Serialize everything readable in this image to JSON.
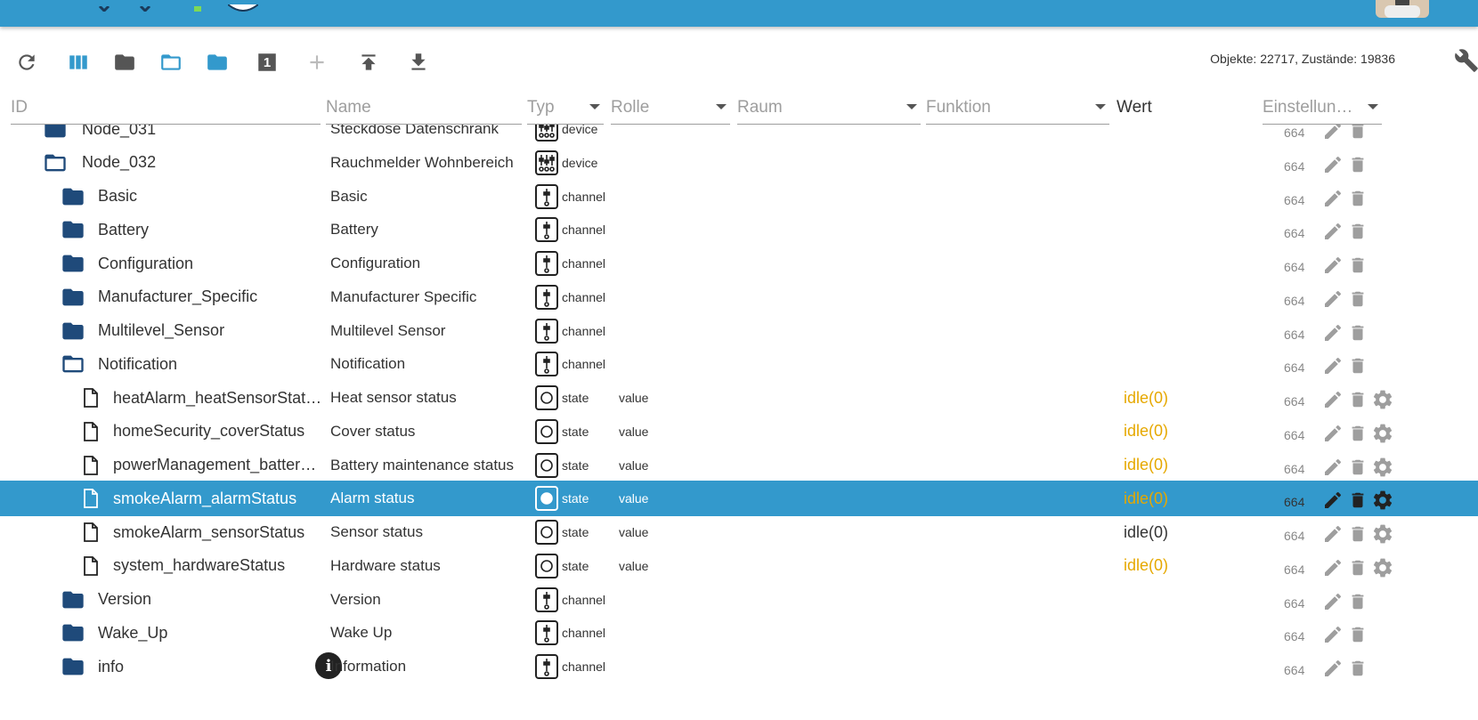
{
  "toolbar": {
    "buttons": [
      {
        "name": "refresh-icon",
        "color": "#555555"
      },
      {
        "name": "columns-icon",
        "color": "#3399cc"
      },
      {
        "name": "folder-icon",
        "color": "#555555"
      },
      {
        "name": "folder-open-icon",
        "color": "#3399cc"
      },
      {
        "name": "folder-icon",
        "color": "#3399cc"
      },
      {
        "name": "number-one-icon",
        "color": "#555555"
      },
      {
        "name": "plus-icon",
        "color": "#bbbbbb"
      },
      {
        "name": "upload-icon",
        "color": "#555555"
      },
      {
        "name": "download-icon",
        "color": "#555555"
      }
    ],
    "counts": "Objekte: 22717, Zustände: 19836",
    "number_label": "1"
  },
  "columns": {
    "id": "ID",
    "name": "Name",
    "typ": "Typ",
    "rolle": "Rolle",
    "raum": "Raum",
    "funktion": "Funktion",
    "wert": "Wert",
    "einstellungen": "Einstellun…"
  },
  "rows": [
    {
      "id": "Node_031",
      "name": "Steckdose Datenschrank",
      "type": "device",
      "role": "",
      "value": "",
      "value_num": "",
      "acl": "664",
      "icon": "folder-icon",
      "level": 0,
      "gear": false,
      "selected": false
    },
    {
      "id": "Node_032",
      "name": "Rauchmelder Wohnbereich",
      "type": "device",
      "role": "",
      "value": "",
      "value_num": "",
      "acl": "664",
      "icon": "folder-open-icon",
      "level": 0,
      "gear": false,
      "selected": false
    },
    {
      "id": "Basic",
      "name": "Basic",
      "type": "channel",
      "role": "",
      "value": "",
      "value_num": "",
      "acl": "664",
      "icon": "folder-icon",
      "level": 1,
      "gear": false,
      "selected": false
    },
    {
      "id": "Battery",
      "name": "Battery",
      "type": "channel",
      "role": "",
      "value": "",
      "value_num": "",
      "acl": "664",
      "icon": "folder-icon",
      "level": 1,
      "gear": false,
      "selected": false
    },
    {
      "id": "Configuration",
      "name": "Configuration",
      "type": "channel",
      "role": "",
      "value": "",
      "value_num": "",
      "acl": "664",
      "icon": "folder-icon",
      "level": 1,
      "gear": false,
      "selected": false
    },
    {
      "id": "Manufacturer_Specific",
      "name": "Manufacturer Specific",
      "type": "channel",
      "role": "",
      "value": "",
      "value_num": "",
      "acl": "664",
      "icon": "folder-icon",
      "level": 1,
      "gear": false,
      "selected": false
    },
    {
      "id": "Multilevel_Sensor",
      "name": "Multilevel Sensor",
      "type": "channel",
      "role": "",
      "value": "",
      "value_num": "",
      "acl": "664",
      "icon": "folder-icon",
      "level": 1,
      "gear": false,
      "selected": false
    },
    {
      "id": "Notification",
      "name": "Notification",
      "type": "channel",
      "role": "",
      "value": "",
      "value_num": "",
      "acl": "664",
      "icon": "folder-open-icon",
      "level": 1,
      "gear": false,
      "selected": false
    },
    {
      "id": "heatAlarm_heatSensorStatus",
      "name": "Heat sensor status",
      "type": "state",
      "role": "value",
      "value": "idle",
      "value_num": "(0)",
      "acl": "664",
      "icon": "file-icon",
      "level": 2,
      "gear": true,
      "selected": false,
      "value_color": "#e6a800"
    },
    {
      "id": "homeSecurity_coverStatus",
      "name": "Cover status",
      "type": "state",
      "role": "value",
      "value": "idle",
      "value_num": "(0)",
      "acl": "664",
      "icon": "file-icon",
      "level": 2,
      "gear": true,
      "selected": false,
      "value_color": "#e6a800"
    },
    {
      "id": "powerManagement_batter…",
      "name": "Battery maintenance status",
      "type": "state",
      "role": "value",
      "value": "idle",
      "value_num": "(0)",
      "acl": "664",
      "icon": "file-icon",
      "level": 2,
      "gear": true,
      "selected": false,
      "value_color": "#e6a800"
    },
    {
      "id": "smokeAlarm_alarmStatus",
      "name": "Alarm status",
      "type": "state",
      "role": "value",
      "value": "idle",
      "value_num": "(0)",
      "acl": "664",
      "icon": "file-icon",
      "level": 2,
      "gear": true,
      "selected": true,
      "value_color": "#e6a800"
    },
    {
      "id": "smokeAlarm_sensorStatus",
      "name": "Sensor status",
      "type": "state",
      "role": "value",
      "value": "idle",
      "value_num": "(0)",
      "acl": "664",
      "icon": "file-icon",
      "level": 2,
      "gear": true,
      "selected": false,
      "value_color": "#333333"
    },
    {
      "id": "system_hardwareStatus",
      "name": "Hardware status",
      "type": "state",
      "role": "value",
      "value": "idle",
      "value_num": "(0)",
      "acl": "664",
      "icon": "file-icon",
      "level": 2,
      "gear": true,
      "selected": false,
      "value_color": "#e6a800"
    },
    {
      "id": "Version",
      "name": "Version",
      "type": "channel",
      "role": "",
      "value": "",
      "value_num": "",
      "acl": "664",
      "icon": "folder-icon",
      "level": 1,
      "gear": false,
      "selected": false
    },
    {
      "id": "Wake_Up",
      "name": "Wake Up",
      "type": "channel",
      "role": "",
      "value": "",
      "value_num": "",
      "acl": "664",
      "icon": "folder-icon",
      "level": 1,
      "gear": false,
      "selected": false
    },
    {
      "id": "info",
      "name": "Information",
      "type": "channel",
      "role": "",
      "value": "",
      "value_num": "",
      "acl": "664",
      "icon": "folder-icon",
      "level": 1,
      "gear": false,
      "selected": false,
      "info": true
    }
  ],
  "colors": {
    "accent": "#3399cc",
    "folder": "#1f4a7a",
    "value_warn": "#e6a800",
    "action_gray": "#9e9e9e"
  }
}
